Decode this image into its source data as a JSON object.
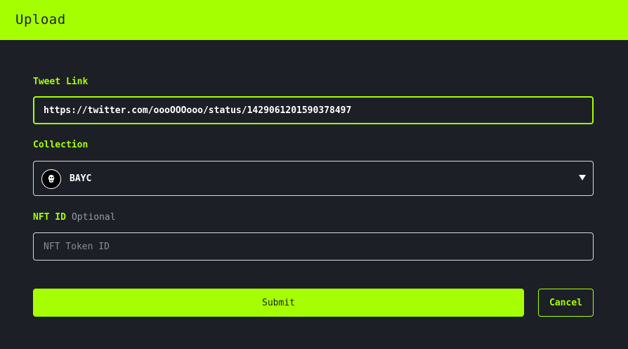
{
  "header": {
    "title": "Upload"
  },
  "form": {
    "tweet_link": {
      "label": "Tweet Link",
      "value": "https://twitter.com/oooOOOooo/status/1429061201590378497"
    },
    "collection": {
      "label": "Collection",
      "selected": "BAYC",
      "logo_icon": "bayc-ape-icon"
    },
    "nft_id": {
      "label": "NFT ID",
      "optional_label": "Optional",
      "placeholder": "NFT Token ID",
      "value": ""
    }
  },
  "actions": {
    "submit_label": "Submit",
    "cancel_label": "Cancel"
  },
  "colors": {
    "accent": "#a6ff00",
    "background": "#1d1f27",
    "text": "#ffffff",
    "muted": "#9a9ca3",
    "border": "#d9d9d9"
  }
}
